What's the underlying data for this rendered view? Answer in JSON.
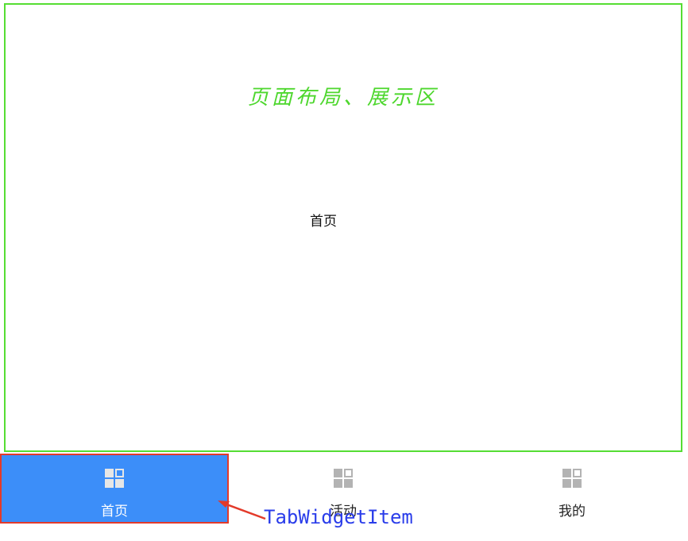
{
  "display_area": {
    "caption": "页面布局、展示区",
    "content_text": "首页",
    "border_color": "#55dd33"
  },
  "tabs": [
    {
      "label": "首页",
      "icon": "grid-icon",
      "active": true
    },
    {
      "label": "活动",
      "icon": "grid-icon",
      "active": false
    },
    {
      "label": "我的",
      "icon": "grid-icon",
      "active": false
    }
  ],
  "annotation": {
    "text": "TabWidgetItem",
    "color": "#2a3dea",
    "arrow_color": "#e33a2a"
  },
  "colors": {
    "active_tab_bg": "#3c8ef9",
    "active_tab_border": "#e33a2a",
    "icon_gray": "#b3b3b3"
  }
}
